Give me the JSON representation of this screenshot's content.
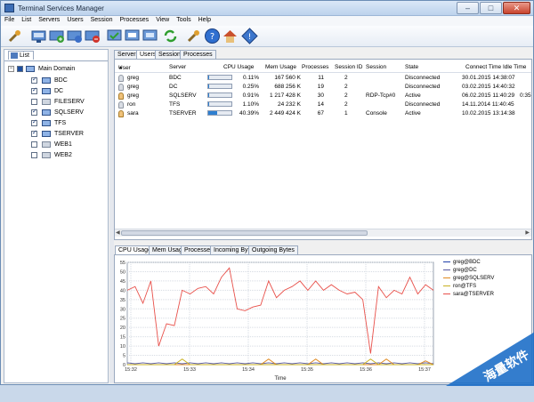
{
  "window": {
    "title": "Terminal Services Manager"
  },
  "menu": [
    "File",
    "List",
    "Servers",
    "Users",
    "Session",
    "Processes",
    "View",
    "Tools",
    "Help"
  ],
  "toolbar_icons": [
    "wrench-icon",
    "server-connect-icon",
    "server-add-icon",
    "server-edit-icon",
    "server-remove-icon",
    "session-icon",
    "session-list-icon",
    "session-refresh-icon",
    "refresh-icon",
    "settings-wrench-icon",
    "help-icon",
    "home-icon",
    "info-icon"
  ],
  "left": {
    "tab": "List",
    "root": "Main Domain",
    "servers": [
      {
        "name": "BDC",
        "checked": true
      },
      {
        "name": "DC",
        "checked": true
      },
      {
        "name": "FILESERV",
        "checked": false
      },
      {
        "name": "SQLSERV",
        "checked": true
      },
      {
        "name": "TFS",
        "checked": true
      },
      {
        "name": "TSERVER",
        "checked": true
      },
      {
        "name": "WEB1",
        "checked": false
      },
      {
        "name": "WEB2",
        "checked": false
      }
    ]
  },
  "top_tabs": [
    "Servers",
    "Users",
    "Sessions",
    "Processes"
  ],
  "grid": {
    "columns": [
      "User",
      "Server",
      "CPU Usage",
      "Mem Usage",
      "Processes",
      "Session ID",
      "Session",
      "State",
      "Connect Time",
      "Idle Time"
    ],
    "rows": [
      {
        "user": "greg",
        "server": "BDC",
        "cpu": "0.11%",
        "cpu_frac": 0.0011,
        "mem": "167 560 K",
        "proc": "11",
        "sid": "2",
        "session": "",
        "state": "Disconnected",
        "connect": "30.01.2015 14:38:07",
        "idle": "",
        "active": false
      },
      {
        "user": "greg",
        "server": "DC",
        "cpu": "0.25%",
        "cpu_frac": 0.0025,
        "mem": "688 256 K",
        "proc": "19",
        "sid": "2",
        "session": "",
        "state": "Disconnected",
        "connect": "03.02.2015 14:40:32",
        "idle": "",
        "active": false
      },
      {
        "user": "greg",
        "server": "SQLSERV",
        "cpu": "0.91%",
        "cpu_frac": 0.0091,
        "mem": "1 217 428 K",
        "proc": "30",
        "sid": "2",
        "session": "RDP-Tcp#0",
        "state": "Active",
        "connect": "06.02.2015 11:40:29",
        "idle": "0:35",
        "active": true
      },
      {
        "user": "ron",
        "server": "TFS",
        "cpu": "1.10%",
        "cpu_frac": 0.011,
        "mem": "24 232 K",
        "proc": "14",
        "sid": "2",
        "session": "",
        "state": "Disconnected",
        "connect": "14.11.2014 11:40:45",
        "idle": "",
        "active": false
      },
      {
        "user": "sara",
        "server": "TSERVER",
        "cpu": "40.39%",
        "cpu_frac": 0.4039,
        "mem": "2 449 424 K",
        "proc": "67",
        "sid": "1",
        "session": "Console",
        "state": "Active",
        "connect": "10.02.2015 13:14:38",
        "idle": "",
        "active": true
      }
    ]
  },
  "bottom_tabs": [
    "CPU Usage",
    "Mem Usage",
    "Processes",
    "Incoming Bytes",
    "Outgoing Bytes"
  ],
  "watermark": "海量软件",
  "chart_data": {
    "type": "line",
    "xlabel": "Time",
    "ylabel": "",
    "x_ticks": [
      "15:32",
      "15:33",
      "15:34",
      "15:35",
      "15:36",
      "15:37"
    ],
    "ylim": [
      0,
      55
    ],
    "y_ticks": [
      0,
      5,
      10,
      15,
      20,
      25,
      30,
      35,
      40,
      45,
      50,
      55
    ],
    "grid": true,
    "legend_position": "right",
    "series": [
      {
        "name": "greg@BDC",
        "color": "#1f3fa8",
        "values": [
          0,
          0,
          0,
          0,
          0,
          0,
          0,
          0,
          0,
          0,
          0,
          0,
          0,
          0,
          0,
          0,
          0,
          0,
          0,
          0,
          0,
          0,
          0,
          0,
          0,
          0,
          0,
          0,
          0,
          0,
          0,
          0,
          0,
          0,
          0,
          0,
          0,
          0,
          0,
          0
        ]
      },
      {
        "name": "greg@DC",
        "color": "#5a5aa0",
        "values": [
          1,
          0.5,
          1,
          0.5,
          1,
          0.5,
          1,
          0.5,
          1,
          0.5,
          1,
          0.5,
          1,
          0.5,
          1,
          0.5,
          1,
          0.5,
          1,
          0.5,
          1,
          0.5,
          1,
          0.5,
          1,
          0.5,
          1,
          0.5,
          1,
          0.5,
          1,
          0.5,
          1,
          0.5,
          1,
          0.5,
          1,
          0.5,
          1,
          0.5
        ]
      },
      {
        "name": "greg@SQLSERV",
        "color": "#e08a20",
        "values": [
          0,
          0,
          0,
          0,
          0,
          0,
          0,
          0,
          0,
          0,
          0,
          0,
          0,
          0,
          0,
          0,
          0,
          0,
          3,
          0,
          0,
          0,
          0,
          0,
          3,
          0,
          0,
          0,
          0,
          0,
          0,
          0,
          0,
          3,
          0,
          0,
          0,
          0,
          2,
          0
        ]
      },
      {
        "name": "ron@TFS",
        "color": "#c8b020",
        "values": [
          0,
          0,
          0,
          0,
          0,
          0,
          0,
          3,
          0,
          0,
          0,
          0,
          0,
          0,
          0,
          0,
          0,
          0,
          0,
          0,
          0,
          0,
          0,
          0,
          0,
          0,
          0,
          0,
          0,
          0,
          0,
          3,
          0,
          0,
          0,
          0,
          0,
          0,
          0,
          0
        ]
      },
      {
        "name": "sara@TSERVER",
        "color": "#e8504a",
        "values": [
          40,
          42,
          33,
          45,
          10,
          22,
          21,
          40,
          38,
          41,
          42,
          38,
          47,
          52,
          30,
          29,
          31,
          32,
          45,
          36,
          40,
          42,
          45,
          40,
          45,
          40,
          43,
          40,
          38,
          39,
          35,
          6,
          42,
          36,
          40,
          38,
          47,
          38,
          43,
          40
        ]
      }
    ]
  }
}
